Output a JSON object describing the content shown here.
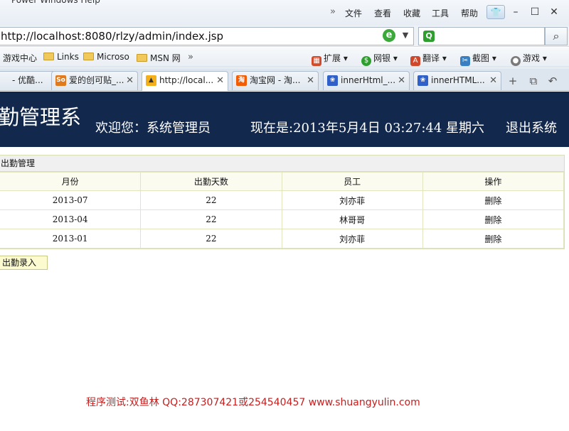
{
  "browser": {
    "menu": [
      "文件",
      "查看",
      "收藏",
      "工具",
      "帮助"
    ],
    "address": "http://localhost:8080/rlzy/admin/index.jsp",
    "favorites": [
      {
        "label": "游戏中心",
        "folder": false
      },
      {
        "label": "Links",
        "folder": true
      },
      {
        "label": "Microso",
        "folder": true
      },
      {
        "label": "MSN 网",
        "folder": true
      }
    ],
    "tools": [
      "扩展",
      "网银",
      "翻译",
      "截图",
      "游戏"
    ],
    "tabs": [
      {
        "label": "- 优酷...",
        "icon": "youku-icon"
      },
      {
        "label": "爱的创可贴_...",
        "icon": "soku-icon"
      },
      {
        "label": "http://local...",
        "icon": "pma-icon",
        "active": true
      },
      {
        "label": "淘宝网 - 淘...",
        "icon": "taobao-icon"
      },
      {
        "label": "innerHtml_...",
        "icon": "baidu-paw-icon"
      },
      {
        "label": "innerHTML...",
        "icon": "baidu-paw-icon"
      }
    ]
  },
  "header": {
    "system_name": "勤管理系",
    "welcome": "欢迎您：系统管理员",
    "datetime": "现在是:2013年5月4日  03:27:44 星期六",
    "logout": "退出系统",
    "background_color": "#13284d"
  },
  "attendance": {
    "panel_title": "出勤管理",
    "columns": [
      "月份",
      "出勤天数",
      "员工",
      "操作"
    ],
    "rows": [
      {
        "month": "2013-07",
        "days": "22",
        "employee": "刘亦菲",
        "action": "删除"
      },
      {
        "month": "2013-04",
        "days": "22",
        "employee": "林哥哥",
        "action": "删除"
      },
      {
        "month": "2013-01",
        "days": "22",
        "employee": "刘亦菲",
        "action": "删除"
      }
    ],
    "add_button": "出勤录入"
  },
  "footer": {
    "text": "程序测试:双鱼林 QQ:287307421或254540457 www.shuangyulin.com",
    "color": "#c61d1d"
  }
}
